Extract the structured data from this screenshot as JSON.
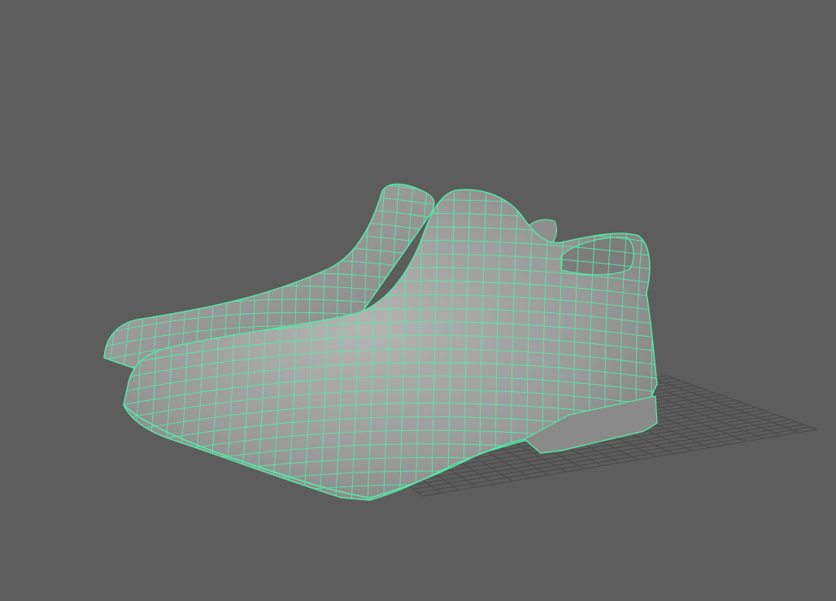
{
  "viewport": {
    "background": "#5d5d5d",
    "wireframe_color": "#55e8a8",
    "shade_color": "#9c9c9c",
    "grid_color": "#4a4a4a"
  },
  "scene": {
    "objects": [
      {
        "name": "shoe-left",
        "display": "wireframe-on-shaded",
        "selected": true
      },
      {
        "name": "shoe-right",
        "display": "wireframe-on-shaded",
        "selected": true
      }
    ],
    "ground_grid": {
      "visible": true
    }
  }
}
